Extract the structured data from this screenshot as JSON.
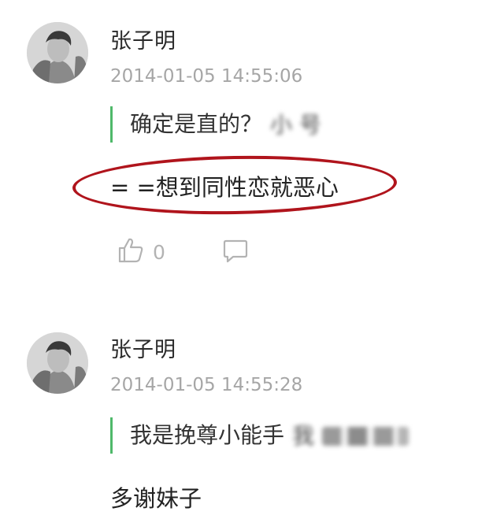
{
  "comments": [
    {
      "username": "张子明",
      "timestamp": "2014-01-05 14:55:06",
      "quote_text": "确定是直的？",
      "quote_blurred_visible": "小 号",
      "reply": "= =想到同性恋就恶心",
      "likes": "0"
    },
    {
      "username": "张子明",
      "timestamp": "2014-01-05 14:55:28",
      "quote_text": "我是挽尊小能手",
      "quote_blurred_visible": "我",
      "reply": "多谢妹子"
    }
  ],
  "icons": {
    "like": "thumbs-up-icon",
    "comment": "speech-bubble-icon"
  },
  "colors": {
    "quote_bar": "#4fb96a",
    "highlight_ellipse": "#b0141c",
    "timestamp": "#a6a6a6"
  }
}
